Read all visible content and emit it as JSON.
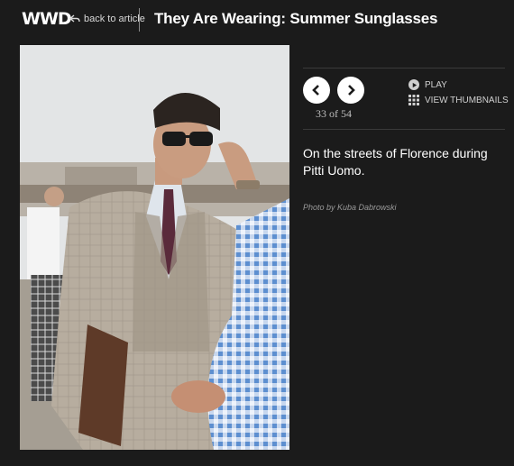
{
  "header": {
    "logo": "WWD",
    "back_label": "back to article",
    "title": "They Are Wearing: Summer Sunglasses"
  },
  "gallery": {
    "counter": "33 of 54",
    "play_label": "PLAY",
    "thumbnails_label": "VIEW THUMBNAILS",
    "caption": "On the streets of Florence during Pitti Uomo.",
    "credit": "Photo by Kuba Dabrowski"
  },
  "colors": {
    "background": "#1b1b1b",
    "text": "#ffffff",
    "muted": "#9a9a9a"
  }
}
